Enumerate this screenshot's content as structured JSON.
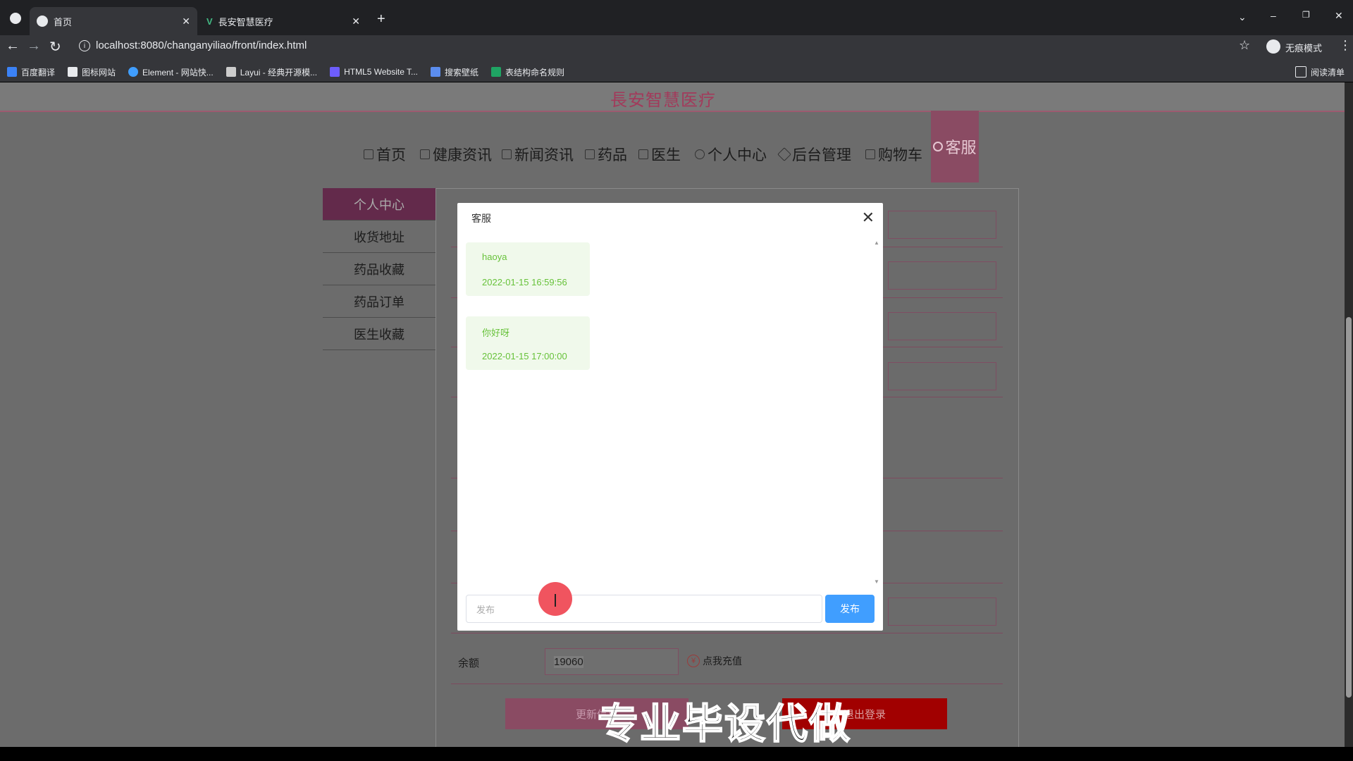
{
  "browser": {
    "tabs": [
      {
        "title": "首页",
        "active": true
      },
      {
        "title": "長安智慧医疗",
        "active": false
      }
    ],
    "new_tab_label": "+",
    "url": "localhost:8080/changanyiliao/front/index.html",
    "profile_label": "无痕模式",
    "bookmarks": [
      "百度翻译",
      "图标网站",
      "Element - 网站快...",
      "Layui - 经典开源模...",
      "HTML5 Website T...",
      "搜索壁纸",
      "表结构命名规则"
    ],
    "reading_list_label": "阅读清单"
  },
  "site": {
    "title": "長安智慧医疗",
    "nav": [
      "首页",
      "健康资讯",
      "新闻资讯",
      "药品",
      "医生",
      "个人中心",
      "后台管理",
      "购物车",
      "客服"
    ]
  },
  "sidebar": {
    "items": [
      "个人中心",
      "收货地址",
      "药品收藏",
      "药品订单",
      "医生收藏"
    ]
  },
  "profile": {
    "balance_label": "余额",
    "balance_value": "19060",
    "recharge_label": "点我充值",
    "update_label": "更新信息",
    "logout_label": "退出登录"
  },
  "modal": {
    "title": "客服",
    "messages": [
      {
        "text": "haoya",
        "time": "2022-01-15 16:59:56"
      },
      {
        "text": "你好呀",
        "time": "2022-01-15 17:00:00"
      }
    ],
    "input_placeholder": "发布",
    "send_label": "发布"
  },
  "watermark": "专业毕设代做",
  "colors": {
    "accent": "#409eff",
    "bubble_bg": "#f0f9eb",
    "bubble_text": "#67c23a",
    "brand": "#d9567f",
    "logout": "#c00000"
  }
}
